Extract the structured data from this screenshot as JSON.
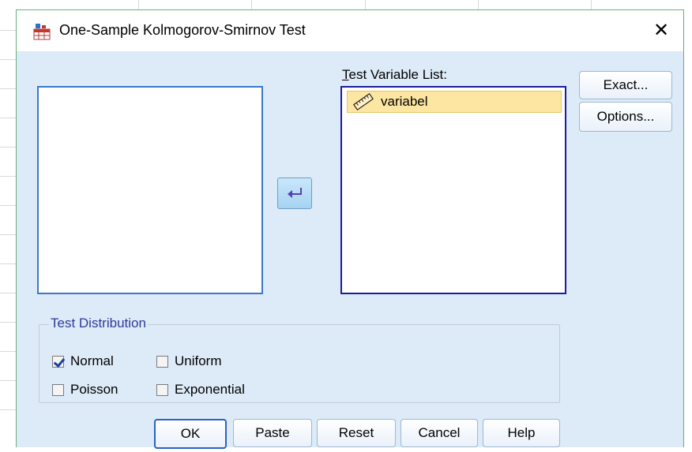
{
  "window": {
    "title": "One-Sample Kolmogorov-Smirnov Test",
    "close_symbol": "✕"
  },
  "source_list": {
    "items": []
  },
  "target": {
    "label": "Test Variable List:",
    "items": [
      "variabel"
    ]
  },
  "buttons": {
    "exact": "Exact...",
    "options": "Options...",
    "ok": "OK",
    "paste": "Paste",
    "reset": "Reset",
    "cancel": "Cancel",
    "help": "Help"
  },
  "test_distribution": {
    "title": "Test Distribution",
    "options": [
      {
        "label": "Normal",
        "checked": true
      },
      {
        "label": "Uniform",
        "checked": false
      },
      {
        "label": "Poisson",
        "checked": false
      },
      {
        "label": "Exponential",
        "checked": false
      }
    ]
  }
}
